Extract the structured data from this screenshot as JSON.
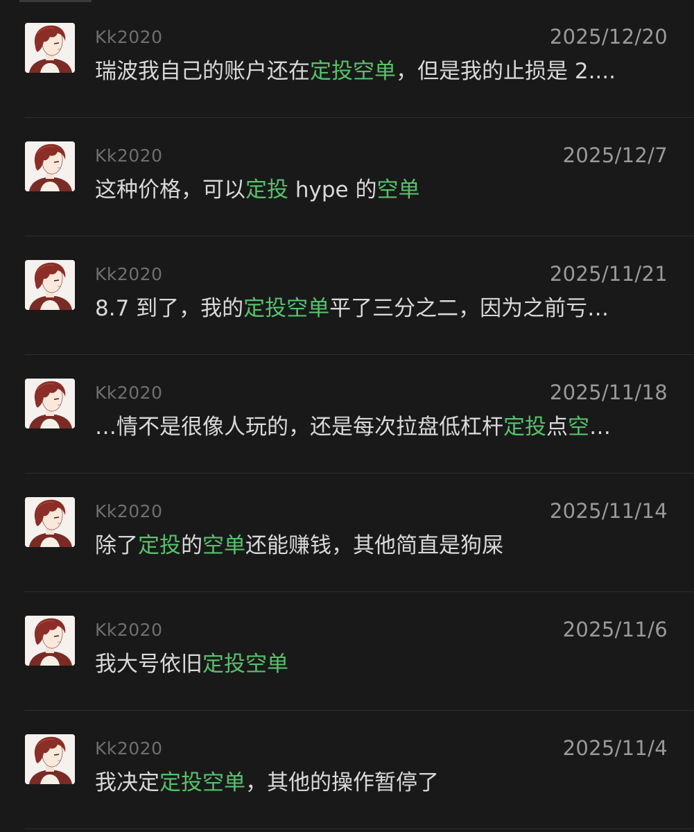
{
  "accent_color": "#57c16c",
  "avatar_icon": "anime-boy-avatar",
  "results": [
    {
      "username": "Kk2020",
      "date": "2025/12/20",
      "segments": [
        {
          "text": "瑞波我自己的账户还在",
          "hl": false
        },
        {
          "text": "定投空单",
          "hl": true
        },
        {
          "text": "，但是我的止损是 2....",
          "hl": false
        }
      ]
    },
    {
      "username": "Kk2020",
      "date": "2025/12/7",
      "segments": [
        {
          "text": "这种价格，可以",
          "hl": false
        },
        {
          "text": "定投",
          "hl": true
        },
        {
          "text": " hype 的",
          "hl": false
        },
        {
          "text": "空单",
          "hl": true
        }
      ]
    },
    {
      "username": "Kk2020",
      "date": "2025/11/21",
      "segments": [
        {
          "text": "8.7 到了，我的",
          "hl": false
        },
        {
          "text": "定投空单",
          "hl": true
        },
        {
          "text": "平了三分之二，因为之前亏…",
          "hl": false
        }
      ]
    },
    {
      "username": "Kk2020",
      "date": "2025/11/18",
      "segments": [
        {
          "text": "…情不是很像人玩的，还是每次拉盘低杠杆",
          "hl": false
        },
        {
          "text": "定投",
          "hl": true
        },
        {
          "text": "点",
          "hl": false
        },
        {
          "text": "空",
          "hl": true
        },
        {
          "text": "…",
          "hl": false
        }
      ]
    },
    {
      "username": "Kk2020",
      "date": "2025/11/14",
      "segments": [
        {
          "text": "除了",
          "hl": false
        },
        {
          "text": "定投",
          "hl": true
        },
        {
          "text": "的",
          "hl": false
        },
        {
          "text": "空单",
          "hl": true
        },
        {
          "text": "还能赚钱，其他简直是狗屎",
          "hl": false
        }
      ]
    },
    {
      "username": "Kk2020",
      "date": "2025/11/6",
      "segments": [
        {
          "text": "我大号依旧",
          "hl": false
        },
        {
          "text": "定投空单",
          "hl": true
        }
      ]
    },
    {
      "username": "Kk2020",
      "date": "2025/11/4",
      "segments": [
        {
          "text": "我决定",
          "hl": false
        },
        {
          "text": "定投空单",
          "hl": true
        },
        {
          "text": "，其他的操作暂停了",
          "hl": false
        }
      ]
    }
  ]
}
